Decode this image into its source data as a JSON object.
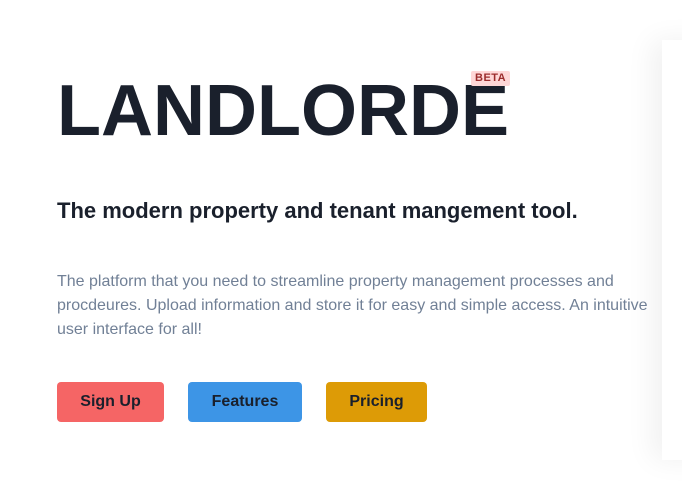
{
  "hero": {
    "title": "LANDLORDE",
    "badge": "BETA",
    "tagline": "The modern property and tenant mangement tool.",
    "description": "The platform that you need to streamline property management processes and procdeures. Upload information and store it for easy and simple access. An intuitive user interface for all!"
  },
  "buttons": {
    "signup": "Sign Up",
    "features": "Features",
    "pricing": "Pricing"
  },
  "colors": {
    "signup": "#f56565",
    "features": "#3d95e6",
    "pricing": "#dd9b06",
    "badge_bg": "#fed7d7",
    "badge_text": "#9b2c2c",
    "heading": "#1a202c",
    "body_text": "#718096"
  }
}
